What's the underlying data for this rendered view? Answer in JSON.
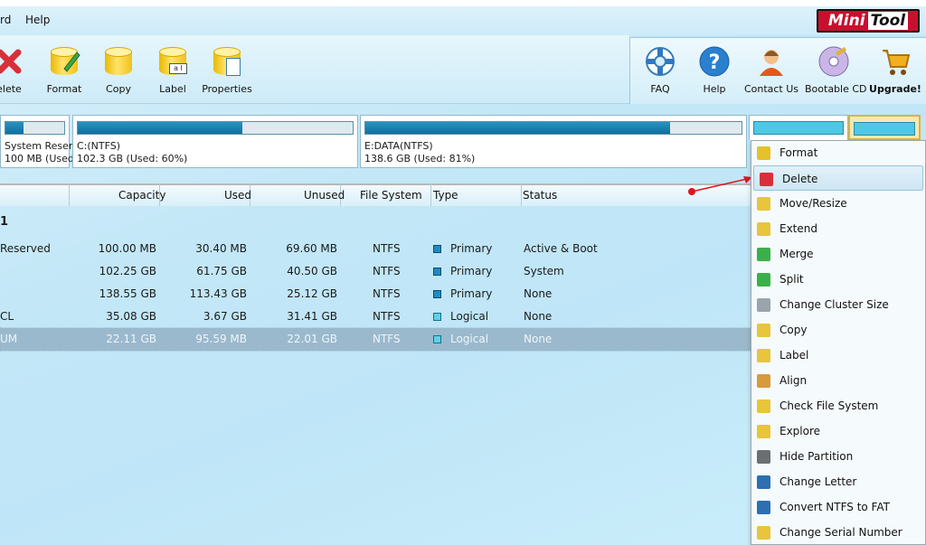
{
  "menu": {
    "items": [
      "rd",
      "Help"
    ]
  },
  "brand": {
    "mini": "Mini",
    "tool": "Tool"
  },
  "toolbar": {
    "left": [
      {
        "label": "elete",
        "icon": "delete-icon"
      },
      {
        "label": "Format",
        "icon": "format-icon"
      },
      {
        "label": "Copy",
        "icon": "copy-icon"
      },
      {
        "label": "Label",
        "icon": "label-icon"
      },
      {
        "label": "Properties",
        "icon": "properties-icon"
      }
    ],
    "right": [
      {
        "label": "FAQ",
        "icon": "lifebuoy-icon"
      },
      {
        "label": "Help",
        "icon": "help-icon"
      },
      {
        "label": "Contact Us",
        "icon": "contact-icon"
      },
      {
        "label": "Bootable CD",
        "icon": "cd-icon"
      },
      {
        "label": "Upgrade!",
        "icon": "cart-icon"
      }
    ]
  },
  "diskmap": {
    "partitions": [
      {
        "name": "System Reserv",
        "info": "100 MB (Used:",
        "used_fraction": 0.3
      },
      {
        "name": "C:(NTFS)",
        "info": "102.3 GB (Used: 60%)",
        "used_fraction": 0.6
      },
      {
        "name": "E:DATA(NTFS)",
        "info": "138.6 GB (Used: 81%)",
        "used_fraction": 0.81
      }
    ]
  },
  "table": {
    "columns": [
      "Capacity",
      "Used",
      "Unused",
      "File System",
      "Type",
      "Status"
    ],
    "disk_label": "1",
    "rows": [
      {
        "partition": "Reserved",
        "capacity": "100.00 MB",
        "used": "30.40 MB",
        "unused": "69.60 MB",
        "fs": "NTFS",
        "type": "Primary",
        "status": "Active & Boot"
      },
      {
        "partition": "",
        "capacity": "102.25 GB",
        "used": "61.75 GB",
        "unused": "40.50 GB",
        "fs": "NTFS",
        "type": "Primary",
        "status": "System"
      },
      {
        "partition": "",
        "capacity": "138.55 GB",
        "used": "113.43 GB",
        "unused": "25.12 GB",
        "fs": "NTFS",
        "type": "Primary",
        "status": "None"
      },
      {
        "partition": "CL",
        "capacity": "35.08 GB",
        "used": "3.67 GB",
        "unused": "31.41 GB",
        "fs": "NTFS",
        "type": "Logical",
        "status": "None"
      },
      {
        "partition": "UM",
        "capacity": "22.11 GB",
        "used": "95.59 MB",
        "unused": "22.01 GB",
        "fs": "NTFS",
        "type": "Logical",
        "status": "None"
      }
    ]
  },
  "context_menu": {
    "items": [
      {
        "label": "Format",
        "icon": "format-icon",
        "color": "#e6c22a"
      },
      {
        "label": "Delete",
        "icon": "delete-icon",
        "color": "#d8303a"
      },
      {
        "label": "Move/Resize",
        "icon": "move-resize-icon",
        "color": "#e8c53a"
      },
      {
        "label": "Extend",
        "icon": "extend-icon",
        "color": "#e8c53a"
      },
      {
        "label": "Merge",
        "icon": "merge-icon",
        "color": "#3bb04a"
      },
      {
        "label": "Split",
        "icon": "split-icon",
        "color": "#3bb04a"
      },
      {
        "label": "Change Cluster Size",
        "icon": "cluster-icon",
        "color": "#9aa4aa"
      },
      {
        "label": "Copy",
        "icon": "copy-icon",
        "color": "#e8c53a"
      },
      {
        "label": "Label",
        "icon": "label-icon",
        "color": "#e8c53a"
      },
      {
        "label": "Align",
        "icon": "align-icon",
        "color": "#d99a3a"
      },
      {
        "label": "Check File System",
        "icon": "check-fs-icon",
        "color": "#e8c53a"
      },
      {
        "label": "Explore",
        "icon": "explore-icon",
        "color": "#e8c53a"
      },
      {
        "label": "Hide Partition",
        "icon": "hide-icon",
        "color": "#6b6f72"
      },
      {
        "label": "Change Letter",
        "icon": "letter-icon",
        "color": "#2d6fb0"
      },
      {
        "label": "Convert NTFS to FAT",
        "icon": "convert-icon",
        "color": "#2d6fb0"
      },
      {
        "label": "Change Serial Number",
        "icon": "serial-icon",
        "color": "#e8c53a"
      }
    ],
    "highlighted": "Delete"
  },
  "colors": {
    "accent": "#1f8bc1",
    "selected_row": "#9bb9cc",
    "brand_red": "#c8102e"
  }
}
